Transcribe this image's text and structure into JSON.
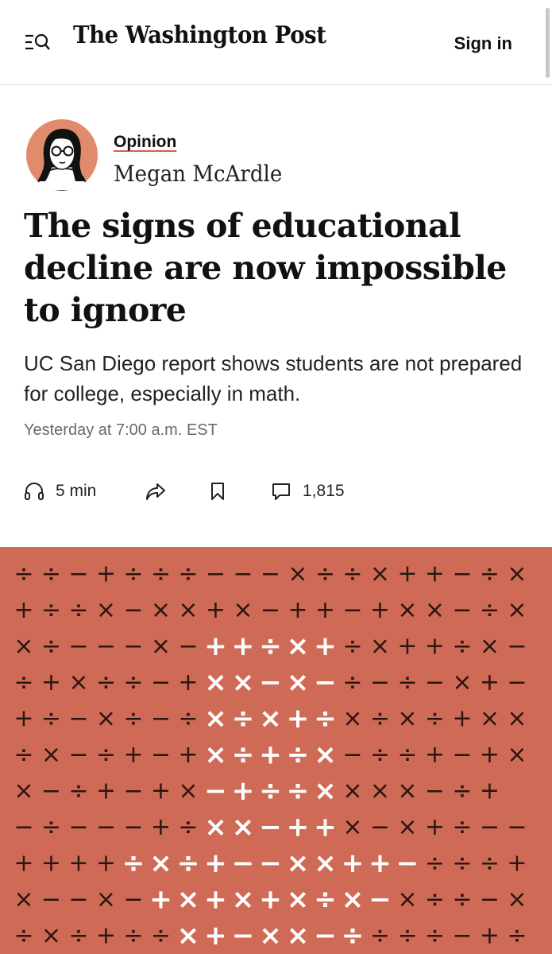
{
  "header": {
    "logo": "The Washington Post",
    "sign_in": "Sign in"
  },
  "byline": {
    "section": "Opinion",
    "author": "Megan McArdle"
  },
  "article": {
    "headline": "The signs of educational decline are now impossible to ignore",
    "subheadline": "UC San Diego report shows students are not prepared for college, especially in math.",
    "timestamp": "Yesterday at 7:00 a.m. EST"
  },
  "actions": {
    "listen_label": "5 min",
    "comments_count": "1,815"
  },
  "hero": {
    "background_color": "#cf6a57",
    "symbols": [
      "÷÷−+÷÷÷−−−×÷÷×++−÷×",
      "+÷÷×−××+×−++−+××−÷×",
      "×÷−−−×−++÷×+÷×++÷×−",
      "÷+×÷÷−+××−×−÷−÷−×+−",
      "+÷−×÷−÷×÷×+÷×÷×÷+××",
      "÷×−÷+−+×÷+÷×−÷÷+−+×",
      "×−÷+−+×−+÷÷××××−÷+",
      "−÷−−−+÷××−++×−×+÷−−",
      "++++÷×÷+−−××++−÷÷÷+",
      "×−−×−+×+×+×÷×−×÷÷−×",
      "÷×÷+÷÷×+−××−÷÷÷÷−+÷"
    ],
    "highlight_ranges": [
      [],
      [],
      [
        7,
        11
      ],
      [
        7,
        11
      ],
      [
        7,
        11
      ],
      [
        7,
        11
      ],
      [
        7,
        11
      ],
      [
        7,
        11
      ],
      [
        4,
        14
      ],
      [
        5,
        13
      ],
      [
        6,
        12
      ]
    ]
  }
}
